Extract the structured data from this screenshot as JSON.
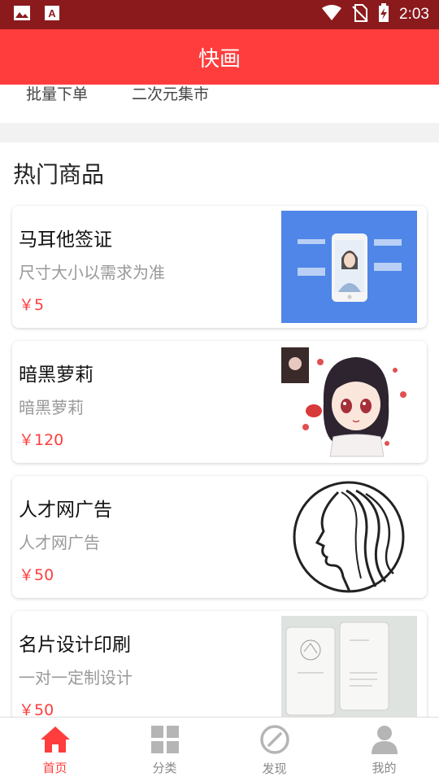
{
  "status_bar": {
    "time": "2:03"
  },
  "title": "快画",
  "quick_links": [
    "批量下单",
    "二次元集市"
  ],
  "section_title": "热门商品",
  "products": [
    {
      "name": "马耳他签证",
      "desc": "尺寸大小以需求为准",
      "price": "￥5"
    },
    {
      "name": "暗黑萝莉",
      "desc": "暗黑萝莉",
      "price": "￥120"
    },
    {
      "name": "人才网广告",
      "desc": "人才网广告",
      "price": "￥50"
    },
    {
      "name": "名片设计印刷",
      "desc": "一对一定制设计",
      "price": "￥50"
    }
  ],
  "bottom_nav": [
    {
      "label": "首页",
      "icon": "home-icon",
      "active": true
    },
    {
      "label": "分类",
      "icon": "grid-icon",
      "active": false
    },
    {
      "label": "发现",
      "icon": "compass-icon",
      "active": false
    },
    {
      "label": "我的",
      "icon": "person-icon",
      "active": false
    }
  ],
  "colors": {
    "accent": "#ff3d3d",
    "status_bar": "#8b1a1d",
    "inactive": "#b5b5b5"
  }
}
